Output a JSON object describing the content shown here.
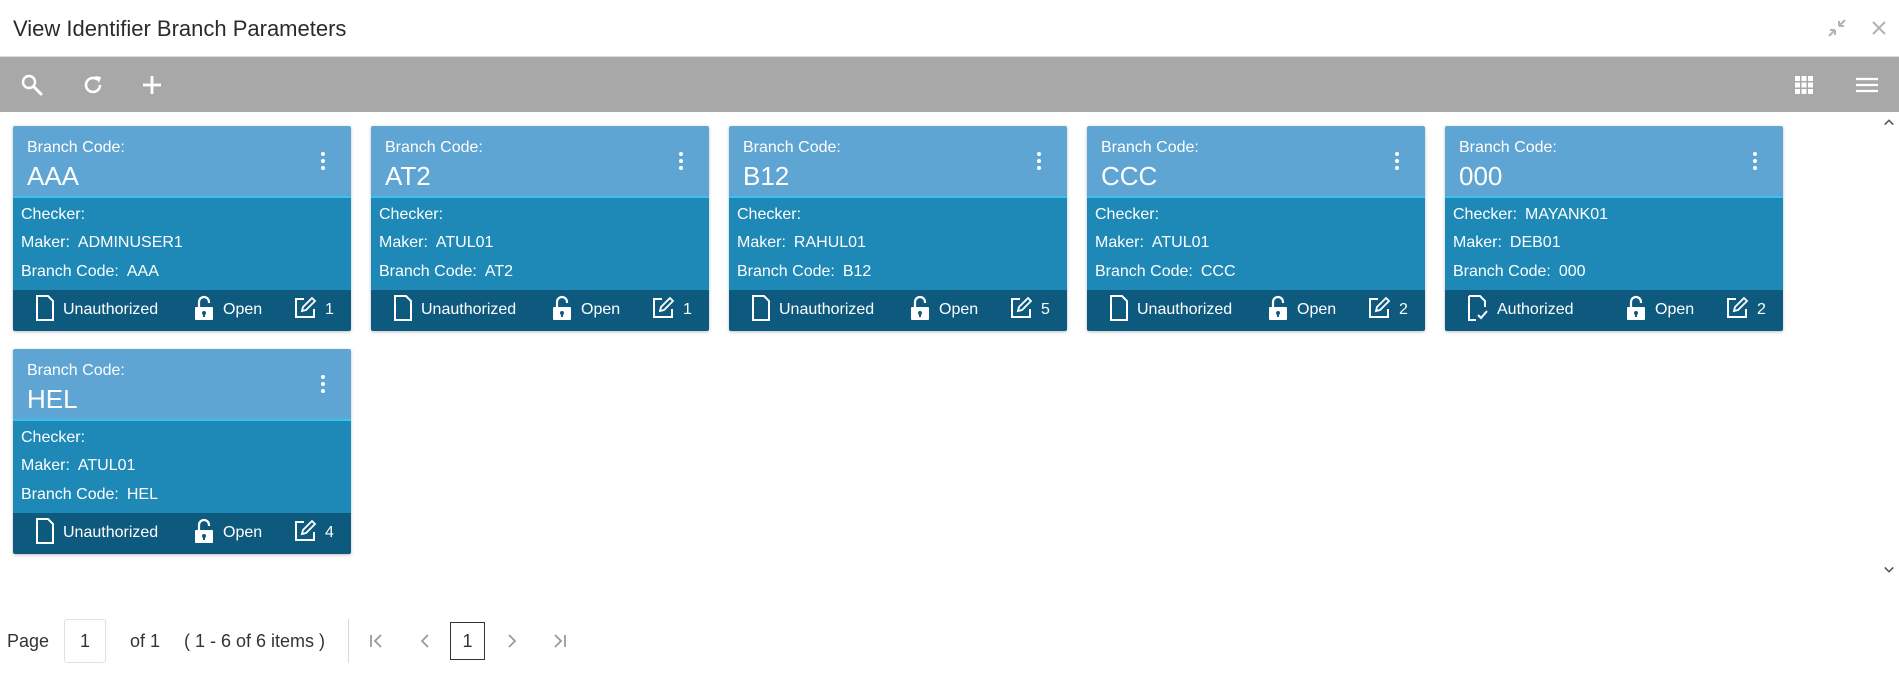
{
  "window": {
    "title": "View Identifier Branch Parameters"
  },
  "toolbar": {
    "search_icon": "search-icon",
    "refresh_icon": "refresh-icon",
    "add_icon": "add-icon",
    "grid_icon": "grid-view-icon",
    "list_icon": "list-view-icon"
  },
  "cards": [
    {
      "branch_code_label": "Branch Code:",
      "branch_code": "AAA",
      "checker_label": "Checker:",
      "checker": "",
      "maker_label": "Maker:",
      "maker": "ADMINUSER1",
      "bc_label": "Branch Code:",
      "bc_value": "AAA",
      "auth_status": "Unauthorized",
      "record_status": "Open",
      "modifications": "1"
    },
    {
      "branch_code_label": "Branch Code:",
      "branch_code": "AT2",
      "checker_label": "Checker:",
      "checker": "",
      "maker_label": "Maker:",
      "maker": "ATUL01",
      "bc_label": "Branch Code:",
      "bc_value": "AT2",
      "auth_status": "Unauthorized",
      "record_status": "Open",
      "modifications": "1"
    },
    {
      "branch_code_label": "Branch Code:",
      "branch_code": "B12",
      "checker_label": "Checker:",
      "checker": "",
      "maker_label": "Maker:",
      "maker": "RAHUL01",
      "bc_label": "Branch Code:",
      "bc_value": "B12",
      "auth_status": "Unauthorized",
      "record_status": "Open",
      "modifications": "5"
    },
    {
      "branch_code_label": "Branch Code:",
      "branch_code": "CCC",
      "checker_label": "Checker:",
      "checker": "",
      "maker_label": "Maker:",
      "maker": "ATUL01",
      "bc_label": "Branch Code:",
      "bc_value": "CCC",
      "auth_status": "Unauthorized",
      "record_status": "Open",
      "modifications": "2"
    },
    {
      "branch_code_label": "Branch Code:",
      "branch_code": "000",
      "checker_label": "Checker:",
      "checker": "MAYANK01",
      "maker_label": "Maker:",
      "maker": "DEB01",
      "bc_label": "Branch Code:",
      "bc_value": "000",
      "auth_status": "Authorized",
      "record_status": "Open",
      "modifications": "2"
    },
    {
      "branch_code_label": "Branch Code:",
      "branch_code": "HEL",
      "checker_label": "Checker:",
      "checker": "",
      "maker_label": "Maker:",
      "maker": "ATUL01",
      "bc_label": "Branch Code:",
      "bc_value": "HEL",
      "auth_status": "Unauthorized",
      "record_status": "Open",
      "modifications": "4"
    }
  ],
  "pagination": {
    "page_label": "Page",
    "page_value": "1",
    "of_label": "of 1",
    "items_label": "( 1 - 6 of 6 items )",
    "current_page": "1"
  },
  "colors": {
    "card_head": "#5ea5d3",
    "card_body": "#1e88b7",
    "card_foot": "#0e5a7e",
    "toolbar": "#a8a8a8"
  }
}
